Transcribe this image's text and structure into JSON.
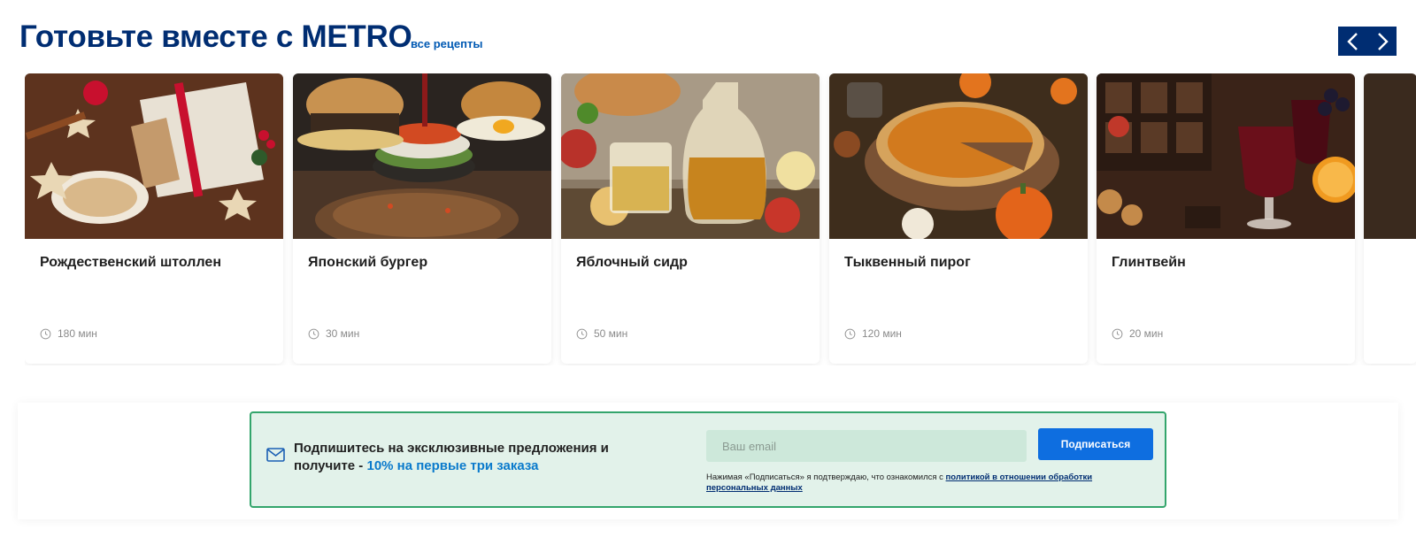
{
  "header": {
    "title": "Готовьте вместе с METRO",
    "all_recipes_link": "все рецепты",
    "prev_icon": "chevron-left-icon",
    "next_icon": "chevron-right-icon",
    "accent_color": "#002d72"
  },
  "recipes": [
    {
      "title": "Рождественский штоллен",
      "time": "180 мин",
      "image": "stollen-photo"
    },
    {
      "title": "Японский бургер",
      "time": "30 мин",
      "image": "burger-photo"
    },
    {
      "title": "Яблочный сидр",
      "time": "50 мин",
      "image": "cider-photo"
    },
    {
      "title": "Тыквенный пирог",
      "time": "120 мин",
      "image": "pumpkin-pie-photo"
    },
    {
      "title": "Глинтвейн",
      "time": "20 мин",
      "image": "mulled-wine-photo"
    }
  ],
  "subscribe": {
    "text_main": "Подпишитесь на эксклюзивные предложения и получите - ",
    "text_highlight": "10% на первые три заказа",
    "email_placeholder": "Ваш email",
    "button_label": "Подписаться",
    "consent_text": "Нажимая «Подписаться» я подтверждаю, что ознакомился с ",
    "consent_link": "политикой в отношении обработки персональных данных",
    "icon": "envelope-icon",
    "background_color": "#e2f2ea",
    "border_color": "#33a56c",
    "button_color": "#0e6ee0"
  }
}
